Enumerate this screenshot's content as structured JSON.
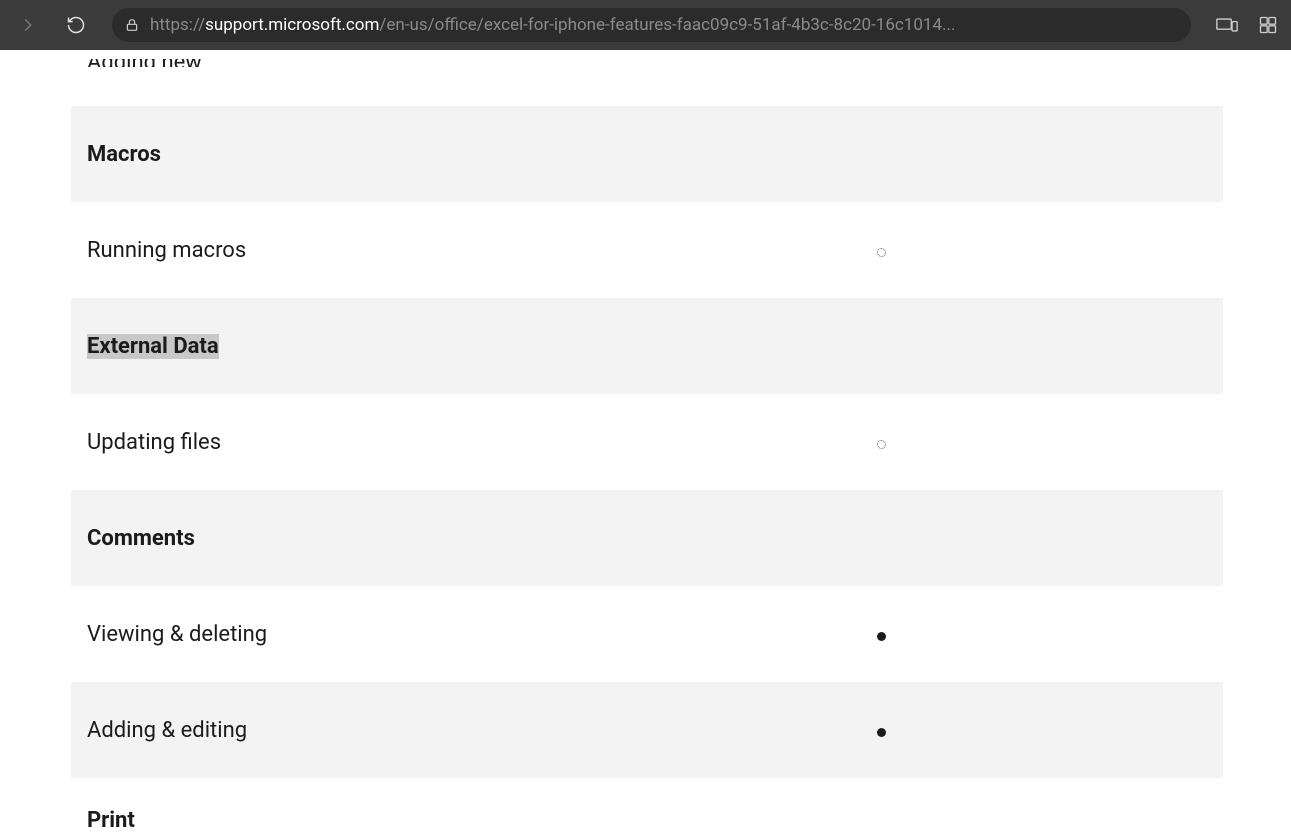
{
  "browser": {
    "url_prefix": "https://",
    "url_domain": "support.microsoft.com",
    "url_path": "/en-us/office/excel-for-iphone-features-faac09c9-51af-4b3c-8c20-16c1014..."
  },
  "table": {
    "cutoff_top": "Adding new",
    "sections": [
      {
        "header": "Macros",
        "header_highlighted": false,
        "rows": [
          {
            "label": "Running macros",
            "indicator": "hollow",
            "alt": false
          }
        ]
      },
      {
        "header": "External Data",
        "header_highlighted": true,
        "rows": [
          {
            "label": "Updating files",
            "indicator": "hollow",
            "alt": false
          }
        ]
      },
      {
        "header": "Comments",
        "header_highlighted": false,
        "rows": [
          {
            "label": "Viewing & deleting",
            "indicator": "filled",
            "alt": false
          },
          {
            "label": "Adding & editing",
            "indicator": "filled",
            "alt": true
          }
        ]
      }
    ],
    "cutoff_bottom": "Print"
  }
}
